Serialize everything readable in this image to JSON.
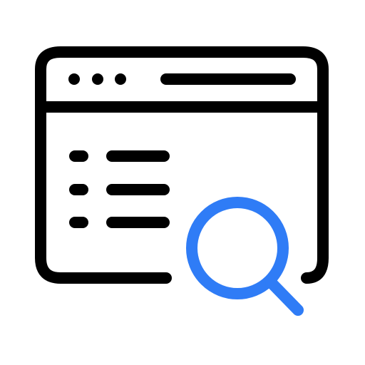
{
  "icon": {
    "name": "web-search-icon",
    "outline_color": "#000000",
    "accent_color": "#2F7CF6",
    "background_color": "#FFFFFF"
  }
}
